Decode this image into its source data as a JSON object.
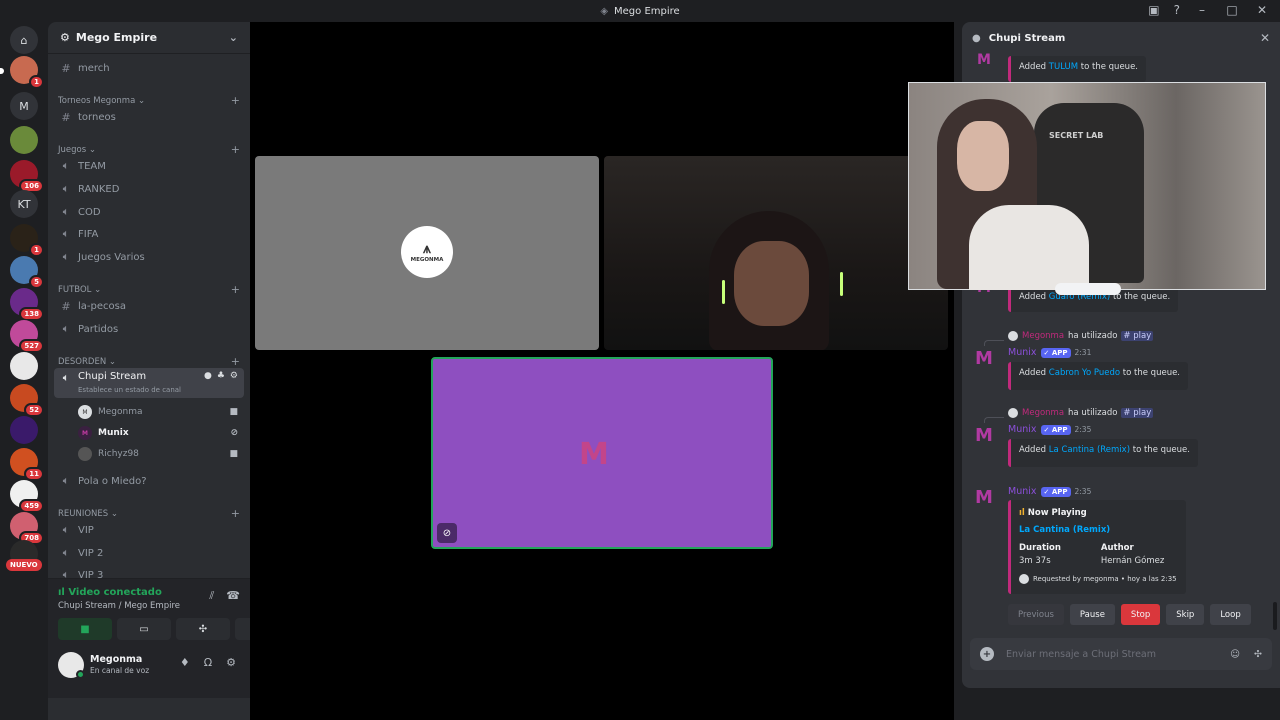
{
  "window": {
    "title": "Mego Empire"
  },
  "rail": {
    "badges": [
      "1",
      "106",
      "1",
      "5",
      "138",
      "527",
      "52",
      "11",
      "459",
      "708"
    ],
    "letters": [
      "M",
      "KT"
    ],
    "nuevo": "NUEVO"
  },
  "server": {
    "name": "Mego Empire",
    "channels": {
      "merch": "merch",
      "cat_torneos": "Torneos Megonma",
      "torneos": "torneos",
      "cat_juegos": "Juegos",
      "team": "TEAM",
      "ranked": "RANKED",
      "cod": "COD",
      "fifa": "FIFA",
      "juegos_varios": "Juegos Varios",
      "cat_futbol": "FUTBOL",
      "la_pecosa": "la-pecosa",
      "partidos": "Partidos",
      "cat_desorden": "DESORDEN",
      "chupi_stream": "Chupi Stream",
      "chupi_status": "Establece un estado de canal",
      "pola": "Pola o Miedo?",
      "cat_reuniones": "REUNIONES",
      "vip": "VIP",
      "vip2": "VIP 2",
      "vip3": "VIP 3"
    },
    "members": [
      "Megonma",
      "Munix",
      "Richyz98"
    ]
  },
  "voice": {
    "status": "Video conectado",
    "location": "Chupi Stream / Mego Empire"
  },
  "user": {
    "name": "Megonma",
    "status": "En canal de voz"
  },
  "stage": {
    "logo_text": "MEGONMA",
    "chair_text": "SECRET LAB"
  },
  "chat": {
    "title": "Chupi Stream",
    "messages": {
      "m1_prefix": "Added ",
      "m1_song": "TULUM",
      "m1_suffix": " to the queue.",
      "m2_prefix": "Added ",
      "m2_song": "Guaro (Remix)",
      "m2_suffix": " to the queue.",
      "invoker": "Megonma",
      "used": "ha utilizado",
      "cmd": "# play",
      "bot": "Munix",
      "app": "APP",
      "t1": "2:31",
      "m3_prefix": "Added ",
      "m3_song": "Cabron Yo Puedo",
      "m3_suffix": " to the queue.",
      "t2": "2:35",
      "m4_prefix": "Added ",
      "m4_song": "La Cantina (Remix)",
      "m4_suffix": " to the queue.",
      "t3": "2:35"
    },
    "now_playing": {
      "title": "Now Playing",
      "song": "La Cantina (Remix)",
      "duration_label": "Duration",
      "duration": "3m 37s",
      "author_label": "Author",
      "author": "Hernán Gómez",
      "requested": "Requested by megonma • hoy a las 2:35"
    },
    "controls": [
      "Previous",
      "Pause",
      "Stop",
      "Skip",
      "Loop"
    ],
    "composer_placeholder": "Enviar mensaje a Chupi Stream"
  }
}
